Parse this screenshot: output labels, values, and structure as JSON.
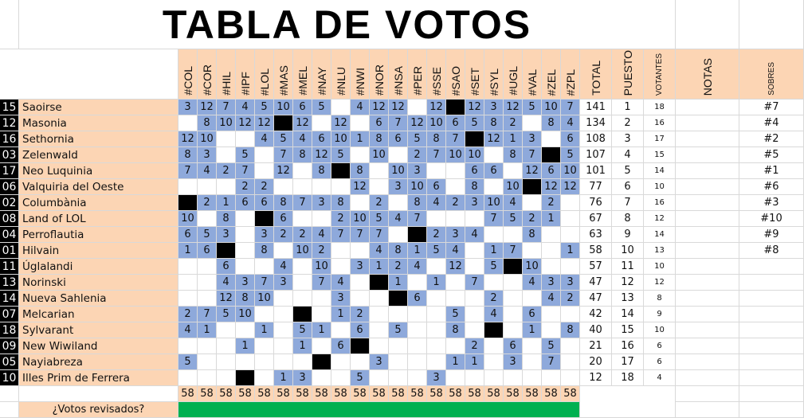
{
  "title": "TABLA DE VOTOS",
  "colors": {
    "header_bg": "#fcd5b4",
    "vote_cell": "#8ea9db",
    "self_cell": "#000000",
    "reviewed_bar": "#00b050",
    "grid": "#d9d9d9"
  },
  "columns": [
    "#COL",
    "#COR",
    "#HIL",
    "#IPF",
    "#LOL",
    "#MAS",
    "#MEL",
    "#NAY",
    "#NLU",
    "#NWI",
    "#NOR",
    "#NSA",
    "#PER",
    "#SSE",
    "#SAO",
    "#SET",
    "#SYL",
    "#UGL",
    "#VAL",
    "#ZEL",
    "#ZPL"
  ],
  "headers": {
    "total": "TOTAL",
    "puesto": "PUESTO",
    "votantes": "VOTANTES",
    "notas": "NOTAS",
    "sobres": "SOBRES"
  },
  "rows": [
    {
      "num": "15",
      "name": "Saoirse",
      "self": 14,
      "votes": [
        3,
        12,
        7,
        4,
        5,
        10,
        6,
        5,
        null,
        4,
        12,
        12,
        null,
        12,
        null,
        12,
        3,
        12,
        5,
        10,
        7
      ],
      "total": "141",
      "puesto": "1",
      "votantes": "18",
      "sobre": "#7"
    },
    {
      "num": "12",
      "name": "Masonia",
      "self": 5,
      "votes": [
        null,
        8,
        10,
        12,
        12,
        null,
        12,
        null,
        12,
        null,
        6,
        7,
        12,
        10,
        6,
        5,
        8,
        2,
        null,
        8,
        4
      ],
      "total": "134",
      "puesto": "2",
      "votantes": "16",
      "sobre": "#4"
    },
    {
      "num": "16",
      "name": "Sethornia",
      "self": 15,
      "votes": [
        12,
        10,
        null,
        null,
        4,
        5,
        4,
        6,
        10,
        1,
        8,
        6,
        5,
        8,
        7,
        null,
        12,
        1,
        3,
        null,
        6
      ],
      "total": "108",
      "puesto": "3",
      "votantes": "17",
      "sobre": "#2"
    },
    {
      "num": "03",
      "name": "Zelenwald",
      "self": 19,
      "votes": [
        8,
        3,
        null,
        5,
        null,
        7,
        8,
        12,
        5,
        null,
        10,
        null,
        2,
        7,
        10,
        10,
        null,
        8,
        7,
        null,
        5
      ],
      "total": "107",
      "puesto": "4",
      "votantes": "15",
      "sobre": "#5"
    },
    {
      "num": "17",
      "name": "Neo Luquinia",
      "self": 8,
      "votes": [
        7,
        4,
        2,
        7,
        null,
        12,
        null,
        8,
        null,
        8,
        null,
        10,
        3,
        null,
        null,
        6,
        6,
        null,
        12,
        6,
        10
      ],
      "total": "101",
      "puesto": "5",
      "votantes": "14",
      "sobre": "#1"
    },
    {
      "num": "06",
      "name": "Valquiria del Oeste",
      "self": 18,
      "votes": [
        null,
        null,
        null,
        2,
        2,
        null,
        null,
        null,
        null,
        12,
        null,
        3,
        10,
        6,
        null,
        8,
        null,
        10,
        null,
        12,
        12
      ],
      "total": "77",
      "puesto": "6",
      "votantes": "10",
      "sobre": "#6"
    },
    {
      "num": "02",
      "name": "Columbània",
      "self": 0,
      "votes": [
        null,
        2,
        1,
        6,
        6,
        8,
        7,
        3,
        8,
        null,
        2,
        null,
        8,
        4,
        2,
        3,
        10,
        4,
        null,
        2,
        null
      ],
      "total": "76",
      "puesto": "7",
      "votantes": "16",
      "sobre": "#3"
    },
    {
      "num": "08",
      "name": "Land of LOL",
      "self": 4,
      "votes": [
        10,
        null,
        8,
        null,
        null,
        6,
        null,
        null,
        2,
        10,
        5,
        4,
        7,
        null,
        null,
        null,
        7,
        5,
        2,
        1,
        null
      ],
      "total": "67",
      "puesto": "8",
      "votantes": "12",
      "sobre": "#10"
    },
    {
      "num": "04",
      "name": "Perroflautia",
      "self": 12,
      "votes": [
        6,
        5,
        3,
        null,
        3,
        2,
        2,
        4,
        7,
        7,
        7,
        null,
        null,
        2,
        3,
        4,
        null,
        null,
        8,
        null,
        null
      ],
      "total": "63",
      "puesto": "9",
      "votantes": "14",
      "sobre": "#9"
    },
    {
      "num": "01",
      "name": "Hilvain",
      "self": 2,
      "votes": [
        1,
        6,
        null,
        null,
        8,
        null,
        10,
        2,
        null,
        null,
        4,
        8,
        1,
        5,
        4,
        null,
        1,
        7,
        null,
        null,
        1
      ],
      "total": "58",
      "puesto": "10",
      "votantes": "13",
      "sobre": "#8"
    },
    {
      "num": "11",
      "name": "Úglalandi",
      "self": 17,
      "votes": [
        null,
        null,
        6,
        null,
        null,
        4,
        null,
        10,
        null,
        3,
        1,
        2,
        4,
        null,
        12,
        null,
        5,
        null,
        10,
        null,
        null
      ],
      "total": "57",
      "puesto": "11",
      "votantes": "10",
      "sobre": ""
    },
    {
      "num": "13",
      "name": "Norinski",
      "self": 10,
      "votes": [
        null,
        null,
        4,
        3,
        7,
        3,
        null,
        7,
        4,
        null,
        null,
        1,
        null,
        1,
        null,
        7,
        null,
        null,
        4,
        3,
        3
      ],
      "total": "47",
      "puesto": "12",
      "votantes": "12",
      "sobre": ""
    },
    {
      "num": "14",
      "name": "Nueva Sahlenia",
      "self": 11,
      "votes": [
        null,
        null,
        12,
        8,
        10,
        null,
        null,
        null,
        3,
        null,
        null,
        null,
        6,
        null,
        null,
        null,
        2,
        null,
        null,
        4,
        2
      ],
      "total": "47",
      "puesto": "13",
      "votantes": "8",
      "sobre": ""
    },
    {
      "num": "07",
      "name": "Melcarian",
      "self": 6,
      "votes": [
        2,
        7,
        5,
        10,
        null,
        null,
        null,
        null,
        1,
        2,
        null,
        null,
        null,
        null,
        5,
        null,
        4,
        null,
        6,
        null,
        null
      ],
      "total": "42",
      "puesto": "14",
      "votantes": "9",
      "sobre": ""
    },
    {
      "num": "18",
      "name": "Sylvarant",
      "self": 16,
      "votes": [
        4,
        1,
        null,
        null,
        1,
        null,
        5,
        1,
        null,
        6,
        null,
        5,
        null,
        null,
        8,
        null,
        null,
        null,
        1,
        null,
        8
      ],
      "total": "40",
      "puesto": "15",
      "votantes": "10",
      "sobre": ""
    },
    {
      "num": "09",
      "name": "New Wiwiland",
      "self": 9,
      "votes": [
        null,
        null,
        null,
        1,
        null,
        null,
        1,
        null,
        6,
        null,
        null,
        null,
        null,
        null,
        null,
        2,
        null,
        6,
        null,
        5,
        null
      ],
      "total": "21",
      "puesto": "16",
      "votantes": "6",
      "sobre": ""
    },
    {
      "num": "05",
      "name": "Nayiabreza",
      "self": 7,
      "votes": [
        5,
        null,
        null,
        null,
        null,
        null,
        null,
        null,
        null,
        null,
        3,
        null,
        null,
        null,
        1,
        1,
        null,
        3,
        null,
        7,
        null
      ],
      "total": "20",
      "puesto": "17",
      "votantes": "6",
      "sobre": ""
    },
    {
      "num": "10",
      "name": "Illes Prim de Ferrera",
      "self": 3,
      "votes": [
        null,
        null,
        null,
        null,
        null,
        1,
        3,
        null,
        null,
        5,
        null,
        null,
        null,
        3,
        null,
        null,
        null,
        null,
        null,
        null,
        null
      ],
      "total": "12",
      "puesto": "18",
      "votantes": "4",
      "sobre": ""
    }
  ],
  "column_totals": [
    "58",
    "58",
    "58",
    "58",
    "58",
    "58",
    "58",
    "58",
    "58",
    "58",
    "58",
    "58",
    "58",
    "58",
    "58",
    "58",
    "58",
    "58",
    "58",
    "58",
    "58"
  ],
  "review": {
    "label": "¿Votos revisados?",
    "reviewed": true
  }
}
